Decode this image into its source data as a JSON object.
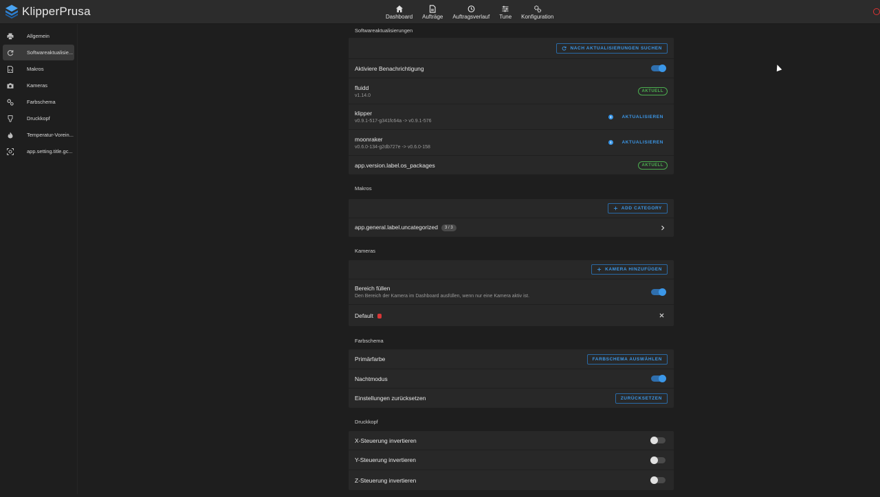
{
  "app": {
    "title": "KlipperPrusa"
  },
  "nav": [
    {
      "label": "Dashboard",
      "icon": "home-icon"
    },
    {
      "label": "Aufträge",
      "icon": "file-icon"
    },
    {
      "label": "Auftragsverlauf",
      "icon": "history-icon"
    },
    {
      "label": "Tune",
      "icon": "sliders-icon"
    },
    {
      "label": "Konfiguration",
      "icon": "gears-icon"
    }
  ],
  "sidebar": {
    "items": [
      {
        "label": "Allgemein",
        "icon": "printer-icon"
      },
      {
        "label": "Softwareaktualisie...",
        "icon": "refresh-icon",
        "active": true
      },
      {
        "label": "Makros",
        "icon": "file-code-icon"
      },
      {
        "label": "Kameras",
        "icon": "camera-icon"
      },
      {
        "label": "Farbschema",
        "icon": "palette-icon"
      },
      {
        "label": "Druckkopf",
        "icon": "nozzle-icon"
      },
      {
        "label": "Temperatur-Vorein...",
        "icon": "fire-icon"
      },
      {
        "label": "app.setting.title.gc...",
        "icon": "gcode-icon"
      }
    ]
  },
  "updates": {
    "title": "Softwareaktualisierungen",
    "check_button": "NACH AKTUALISIERUNGEN SUCHEN",
    "notify_label": "Aktiviere Benachrichtigung",
    "notify_on": true,
    "fluidd": {
      "name": "fluidd",
      "version": "v1.14.0",
      "status": "AKTUELL"
    },
    "klipper": {
      "name": "klipper",
      "version": "v0.9.1-517-g341fc64a -> v0.9.1-576",
      "action": "AKTUALISIEREN"
    },
    "moonraker": {
      "name": "moonraker",
      "version": "v0.6.0-134-g2db727e -> v0.6.0-158",
      "action": "AKTUALISIEREN"
    },
    "os": {
      "name": "app.version.label.os_packages",
      "status": "AKTUELL"
    }
  },
  "macros": {
    "title": "Makros",
    "add_button": "ADD CATEGORY",
    "category_label": "app.general.label.uncategorized",
    "category_count": "3 / 3"
  },
  "cameras": {
    "title": "Kameras",
    "add_button": "KAMERA HINZUFÜGEN",
    "fill_label": "Bereich füllen",
    "fill_desc": "Den Bereich der Kamera im Dashboard ausfüllen, wenn nur eine Kamera aktiv ist.",
    "fill_on": true,
    "default_label": "Default"
  },
  "theme": {
    "title": "Farbschema",
    "primary_label": "Primärfarbe",
    "primary_button": "FARBSCHEMA AUSWÄHLEN",
    "dark_label": "Nachtmodus",
    "dark_on": true,
    "reset_label": "Einstellungen zurücksetzen",
    "reset_button": "ZURÜCKSETZEN"
  },
  "toolhead": {
    "title": "Druckkopf",
    "invert_x": "X-Steuerung invertieren",
    "invert_y": "Y-Steuerung invertieren",
    "invert_z": "Z-Steuerung invertieren"
  },
  "colors": {
    "accent": "#3b97e8",
    "ok": "#4caf50",
    "danger": "#d93636"
  }
}
